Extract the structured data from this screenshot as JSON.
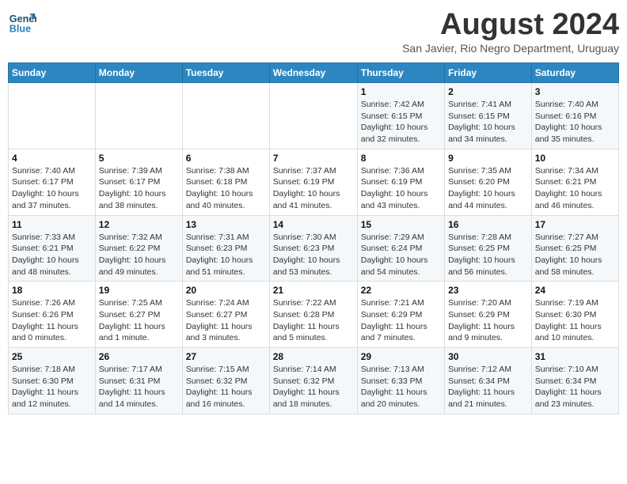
{
  "logo": {
    "line1": "General",
    "line2": "Blue"
  },
  "title": "August 2024",
  "subtitle": "San Javier, Rio Negro Department, Uruguay",
  "headers": [
    "Sunday",
    "Monday",
    "Tuesday",
    "Wednesday",
    "Thursday",
    "Friday",
    "Saturday"
  ],
  "weeks": [
    [
      {
        "day": "",
        "detail": ""
      },
      {
        "day": "",
        "detail": ""
      },
      {
        "day": "",
        "detail": ""
      },
      {
        "day": "",
        "detail": ""
      },
      {
        "day": "1",
        "detail": "Sunrise: 7:42 AM\nSunset: 6:15 PM\nDaylight: 10 hours\nand 32 minutes."
      },
      {
        "day": "2",
        "detail": "Sunrise: 7:41 AM\nSunset: 6:15 PM\nDaylight: 10 hours\nand 34 minutes."
      },
      {
        "day": "3",
        "detail": "Sunrise: 7:40 AM\nSunset: 6:16 PM\nDaylight: 10 hours\nand 35 minutes."
      }
    ],
    [
      {
        "day": "4",
        "detail": "Sunrise: 7:40 AM\nSunset: 6:17 PM\nDaylight: 10 hours\nand 37 minutes."
      },
      {
        "day": "5",
        "detail": "Sunrise: 7:39 AM\nSunset: 6:17 PM\nDaylight: 10 hours\nand 38 minutes."
      },
      {
        "day": "6",
        "detail": "Sunrise: 7:38 AM\nSunset: 6:18 PM\nDaylight: 10 hours\nand 40 minutes."
      },
      {
        "day": "7",
        "detail": "Sunrise: 7:37 AM\nSunset: 6:19 PM\nDaylight: 10 hours\nand 41 minutes."
      },
      {
        "day": "8",
        "detail": "Sunrise: 7:36 AM\nSunset: 6:19 PM\nDaylight: 10 hours\nand 43 minutes."
      },
      {
        "day": "9",
        "detail": "Sunrise: 7:35 AM\nSunset: 6:20 PM\nDaylight: 10 hours\nand 44 minutes."
      },
      {
        "day": "10",
        "detail": "Sunrise: 7:34 AM\nSunset: 6:21 PM\nDaylight: 10 hours\nand 46 minutes."
      }
    ],
    [
      {
        "day": "11",
        "detail": "Sunrise: 7:33 AM\nSunset: 6:21 PM\nDaylight: 10 hours\nand 48 minutes."
      },
      {
        "day": "12",
        "detail": "Sunrise: 7:32 AM\nSunset: 6:22 PM\nDaylight: 10 hours\nand 49 minutes."
      },
      {
        "day": "13",
        "detail": "Sunrise: 7:31 AM\nSunset: 6:23 PM\nDaylight: 10 hours\nand 51 minutes."
      },
      {
        "day": "14",
        "detail": "Sunrise: 7:30 AM\nSunset: 6:23 PM\nDaylight: 10 hours\nand 53 minutes."
      },
      {
        "day": "15",
        "detail": "Sunrise: 7:29 AM\nSunset: 6:24 PM\nDaylight: 10 hours\nand 54 minutes."
      },
      {
        "day": "16",
        "detail": "Sunrise: 7:28 AM\nSunset: 6:25 PM\nDaylight: 10 hours\nand 56 minutes."
      },
      {
        "day": "17",
        "detail": "Sunrise: 7:27 AM\nSunset: 6:25 PM\nDaylight: 10 hours\nand 58 minutes."
      }
    ],
    [
      {
        "day": "18",
        "detail": "Sunrise: 7:26 AM\nSunset: 6:26 PM\nDaylight: 11 hours\nand 0 minutes."
      },
      {
        "day": "19",
        "detail": "Sunrise: 7:25 AM\nSunset: 6:27 PM\nDaylight: 11 hours\nand 1 minute."
      },
      {
        "day": "20",
        "detail": "Sunrise: 7:24 AM\nSunset: 6:27 PM\nDaylight: 11 hours\nand 3 minutes."
      },
      {
        "day": "21",
        "detail": "Sunrise: 7:22 AM\nSunset: 6:28 PM\nDaylight: 11 hours\nand 5 minutes."
      },
      {
        "day": "22",
        "detail": "Sunrise: 7:21 AM\nSunset: 6:29 PM\nDaylight: 11 hours\nand 7 minutes."
      },
      {
        "day": "23",
        "detail": "Sunrise: 7:20 AM\nSunset: 6:29 PM\nDaylight: 11 hours\nand 9 minutes."
      },
      {
        "day": "24",
        "detail": "Sunrise: 7:19 AM\nSunset: 6:30 PM\nDaylight: 11 hours\nand 10 minutes."
      }
    ],
    [
      {
        "day": "25",
        "detail": "Sunrise: 7:18 AM\nSunset: 6:30 PM\nDaylight: 11 hours\nand 12 minutes."
      },
      {
        "day": "26",
        "detail": "Sunrise: 7:17 AM\nSunset: 6:31 PM\nDaylight: 11 hours\nand 14 minutes."
      },
      {
        "day": "27",
        "detail": "Sunrise: 7:15 AM\nSunset: 6:32 PM\nDaylight: 11 hours\nand 16 minutes."
      },
      {
        "day": "28",
        "detail": "Sunrise: 7:14 AM\nSunset: 6:32 PM\nDaylight: 11 hours\nand 18 minutes."
      },
      {
        "day": "29",
        "detail": "Sunrise: 7:13 AM\nSunset: 6:33 PM\nDaylight: 11 hours\nand 20 minutes."
      },
      {
        "day": "30",
        "detail": "Sunrise: 7:12 AM\nSunset: 6:34 PM\nDaylight: 11 hours\nand 21 minutes."
      },
      {
        "day": "31",
        "detail": "Sunrise: 7:10 AM\nSunset: 6:34 PM\nDaylight: 11 hours\nand 23 minutes."
      }
    ]
  ]
}
